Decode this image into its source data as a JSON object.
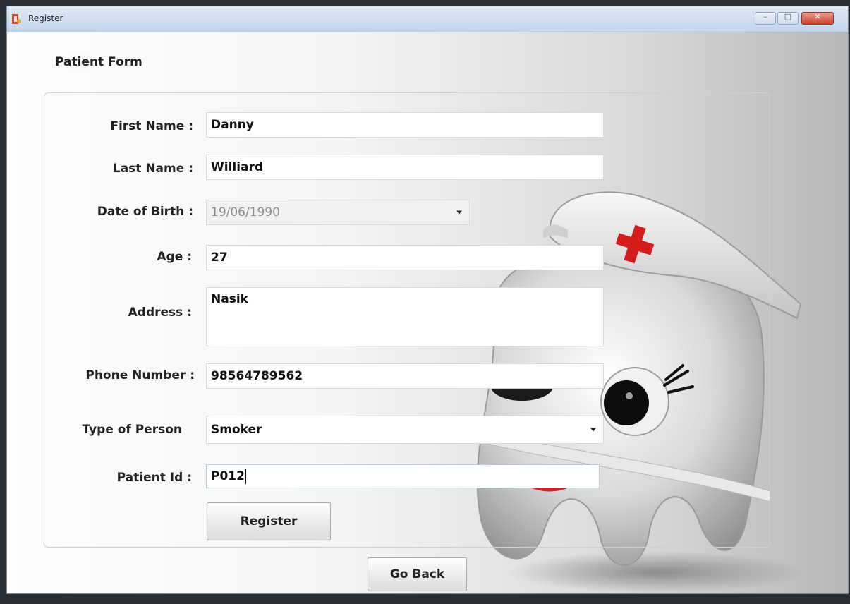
{
  "window": {
    "title": "Register",
    "controls": {
      "minimize": "–",
      "maximize": "□",
      "close": "✕"
    }
  },
  "form": {
    "legend": "Patient Form",
    "first_name": {
      "label": "First Name :",
      "value": "Danny"
    },
    "last_name": {
      "label": "Last Name :",
      "value": "Williard"
    },
    "dob": {
      "label": "Date of Birth :",
      "value": "19/06/1990"
    },
    "age": {
      "label": "Age :",
      "value": "27"
    },
    "address": {
      "label": "Address :",
      "value": "Nasik"
    },
    "phone": {
      "label": "Phone Number :",
      "value": "98564789562"
    },
    "person_type": {
      "label": "Type of Person",
      "value": "Smoker"
    },
    "patient_id": {
      "label": "Patient Id :",
      "value": "P012"
    },
    "register_label": "Register"
  },
  "go_back_label": "Go Back",
  "colors": {
    "cross": "#d41c1c",
    "mouth": "#c8231f"
  }
}
